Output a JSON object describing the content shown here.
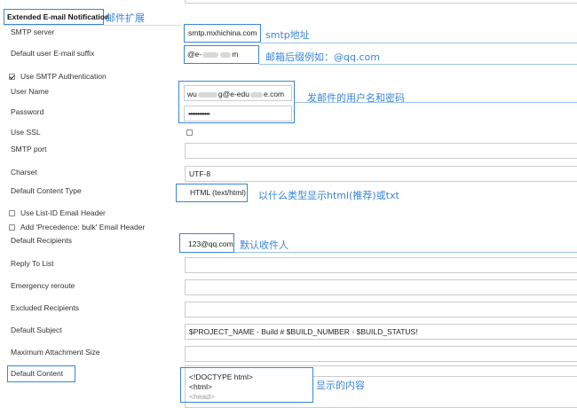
{
  "section": {
    "title": "Extended E-mail Notification",
    "note": "邮件扩展"
  },
  "fields": {
    "smtp_server": {
      "label": "SMTP server",
      "value": "smtp.mxhichina.com",
      "note": "smtp地址"
    },
    "suffix": {
      "label": "Default user E-mail suffix",
      "value_start": "@e-",
      "value_end": "m",
      "note": "邮箱后缀例如：@qq.com"
    },
    "use_smtp_auth": {
      "label": "Use SMTP Authentication",
      "checked": true
    },
    "user_name": {
      "label": "User Name",
      "value_start": "wu",
      "value_mid": "g@e-edu",
      "value_end": "e.com",
      "note": "发邮件的用户名和密码"
    },
    "password": {
      "label": "Password",
      "value": "••••••••••••"
    },
    "use_ssl": {
      "label": "Use SSL",
      "checked": false
    },
    "smtp_port": {
      "label": "SMTP port",
      "value": ""
    },
    "charset": {
      "label": "Charset",
      "value": "UTF-8"
    },
    "content_type": {
      "label": "Default Content Type",
      "value": "HTML (text/html)",
      "note": "以什么类型显示html(推荐)或txt"
    },
    "list_id": {
      "label": "Use List-ID Email Header",
      "checked": false
    },
    "precedence": {
      "label": "Add 'Precedence: bulk' Email Header",
      "checked": false
    },
    "recipients": {
      "label": "Default Recipients",
      "value": "123@qq.com",
      "note": "默认收件人"
    },
    "reply_to": {
      "label": "Reply To List",
      "value": ""
    },
    "emergency": {
      "label": "Emergency reroute",
      "value": ""
    },
    "excluded": {
      "label": "Excluded Recipients",
      "value": ""
    },
    "subject": {
      "label": "Default Subject",
      "value": "$PROJECT_NAME - Build # $BUILD_NUMBER - $BUILD_STATUS!"
    },
    "max_attach": {
      "label": "Maximum Attachment Size",
      "value": ""
    },
    "content": {
      "label": "Default Content",
      "lines": [
        "<!DOCTYPE html>",
        "<html>",
        "<head>"
      ],
      "note": "显示的内容"
    }
  },
  "colors": {
    "accent": "#3a84d8"
  }
}
